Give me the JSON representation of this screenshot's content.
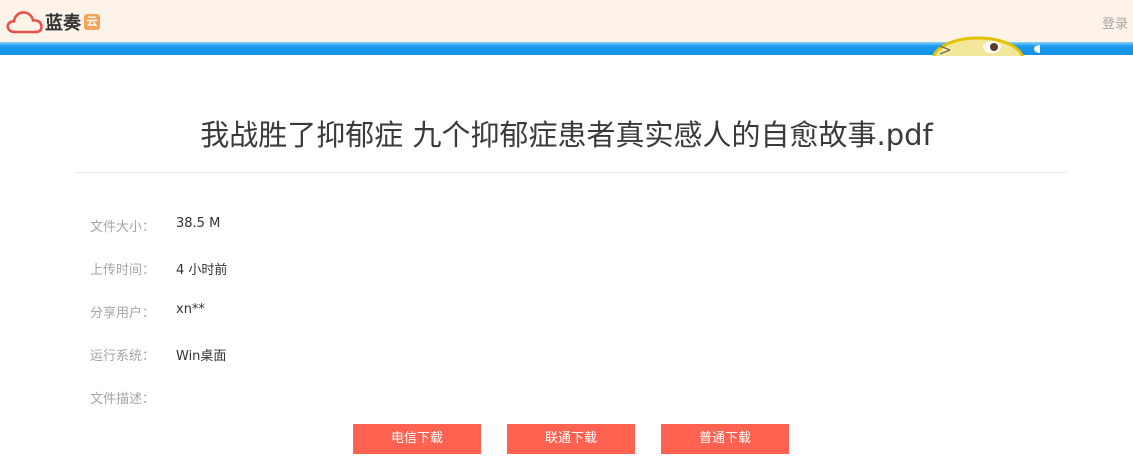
{
  "header": {
    "logo_text": "蓝奏",
    "logo_badge": "云",
    "login_label": "登录"
  },
  "file": {
    "title": "我战胜了抑郁症 九个抑郁症患者真实感人的自愈故事.pdf"
  },
  "info": [
    {
      "label": "文件大小：",
      "value": "38.5 M"
    },
    {
      "label": "上传时间：",
      "value": "4 小时前"
    },
    {
      "label": "分享用户：",
      "value": "xn**"
    },
    {
      "label": "运行系统：",
      "value": "Win桌面"
    },
    {
      "label": "文件描述：",
      "value": ""
    }
  ],
  "buttons": {
    "telecom": "电信下载",
    "unicom": "联通下载",
    "normal": "普通下载"
  },
  "colors": {
    "topbar_bg": "#fdf3e8",
    "accent_blue": "#0f8fe8",
    "button_red": "#ff6251",
    "logo_red": "#e8524a"
  },
  "icons": {
    "logo": "cloud-logo-icon",
    "mascot": "mascot-icon"
  }
}
